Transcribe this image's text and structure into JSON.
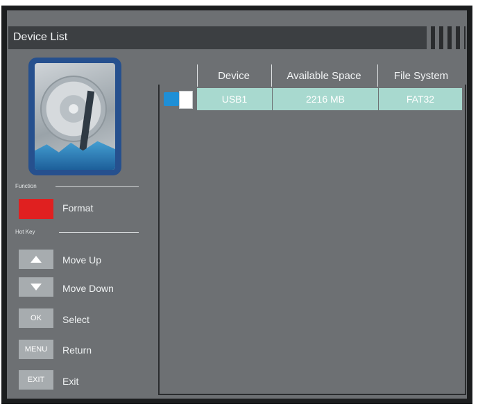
{
  "window": {
    "title": "Device List"
  },
  "sidebar": {
    "device_image": "hard-disk-illustration",
    "function_header": "Function",
    "function_key": {
      "color": "#e02020",
      "label": "Format"
    },
    "hotkey_header": "Hot Key",
    "hotkeys": [
      {
        "key": "up-arrow",
        "label": "Move Up"
      },
      {
        "key": "down-arrow",
        "label": "Move Down"
      },
      {
        "key": "OK",
        "label": "Select"
      },
      {
        "key": "MENU",
        "label": "Return"
      },
      {
        "key": "EXIT",
        "label": "Exit"
      }
    ]
  },
  "table": {
    "columns": [
      "Device",
      "Available Space",
      "File System"
    ],
    "rows": [
      {
        "icon": "usb-icon",
        "device": "USB1",
        "space": "2216 MB",
        "fs": "FAT32"
      }
    ]
  },
  "colors": {
    "screen": "#6d7073",
    "selection": "#a8d9cf",
    "accent": "#e02020"
  }
}
